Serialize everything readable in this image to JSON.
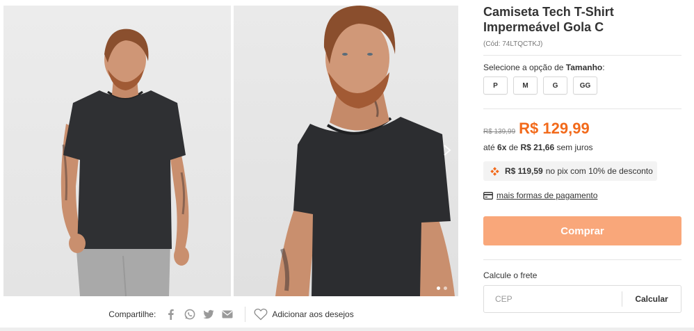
{
  "product": {
    "title_line1": "Camiseta Tech T-Shirt",
    "title_line2": "Impermeável Gola C",
    "code": "(Cód: 74LTQCTKJ)"
  },
  "size_selector": {
    "label_prefix": "Selecione a opção de",
    "label_option": "Tamanho",
    "label_suffix": ":",
    "options": [
      "P",
      "M",
      "G",
      "GG"
    ]
  },
  "pricing": {
    "old_price": "R$ 139,99",
    "price": "R$ 129,99",
    "installments_prefix": "até",
    "installments_count": "6x",
    "installments_of": "de",
    "installments_value": "R$ 21,66",
    "installments_suffix": "sem juros",
    "pix_value": "R$ 119,59",
    "pix_text": "no pix com 10% de desconto",
    "more_payment_link": "mais formas de pagamento"
  },
  "actions": {
    "buy_label": "Comprar"
  },
  "shipping": {
    "label": "Calcule o frete",
    "cep_placeholder": "CEP",
    "calculate_label": "Calcular"
  },
  "share": {
    "label": "Compartilhe:",
    "icons": [
      "facebook-icon",
      "whatsapp-icon",
      "twitter-icon",
      "email-icon"
    ],
    "wishlist_label": "Adicionar aos desejos"
  },
  "gallery": {
    "dots_total": 2,
    "active_dot": 1
  },
  "colors": {
    "price_orange": "#f26a1b",
    "buy_button": "#f9a77a",
    "pix_icon": "#f26a1b",
    "share_icon_gray": "#9a9a9a"
  }
}
